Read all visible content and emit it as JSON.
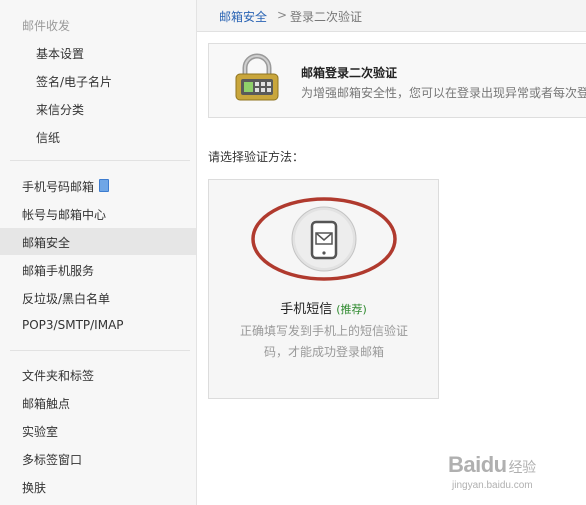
{
  "sidebar": {
    "group_title": "邮件收发",
    "sub_items": [
      {
        "label": "基本设置"
      },
      {
        "label": "签名/电子名片"
      },
      {
        "label": "来信分类"
      },
      {
        "label": "信纸"
      }
    ],
    "items": [
      {
        "label": "手机号码邮箱"
      },
      {
        "label": "帐号与邮箱中心"
      },
      {
        "label": "邮箱安全"
      },
      {
        "label": "邮箱手机服务"
      },
      {
        "label": "反垃圾/黑白名单"
      },
      {
        "label": "POP3/SMTP/IMAP"
      }
    ],
    "items2": [
      {
        "label": "文件夹和标签"
      },
      {
        "label": "邮箱触点"
      },
      {
        "label": "实验室"
      },
      {
        "label": "多标签窗口"
      },
      {
        "label": "换肤"
      }
    ]
  },
  "breadcrumb": {
    "parent": "邮箱安全",
    "separator": ">",
    "current": "登录二次验证"
  },
  "info": {
    "title": "邮箱登录二次验证",
    "description": "为增强邮箱安全性，您可以在登录出现异常或者每次登"
  },
  "prompt": "请选择验证方法：",
  "method": {
    "title": "手机短信",
    "recommend": "(推荐)",
    "description": "正确填写发到手机上的短信验证码，才能成功登录邮箱"
  },
  "watermark": {
    "main": "Baidu",
    "main_cn": "经验",
    "sub": "jingyan.baidu.com"
  },
  "colors": {
    "link": "#2a64b4",
    "recommend": "#2f8a2f",
    "highlight_ring": "#b03a2e"
  }
}
